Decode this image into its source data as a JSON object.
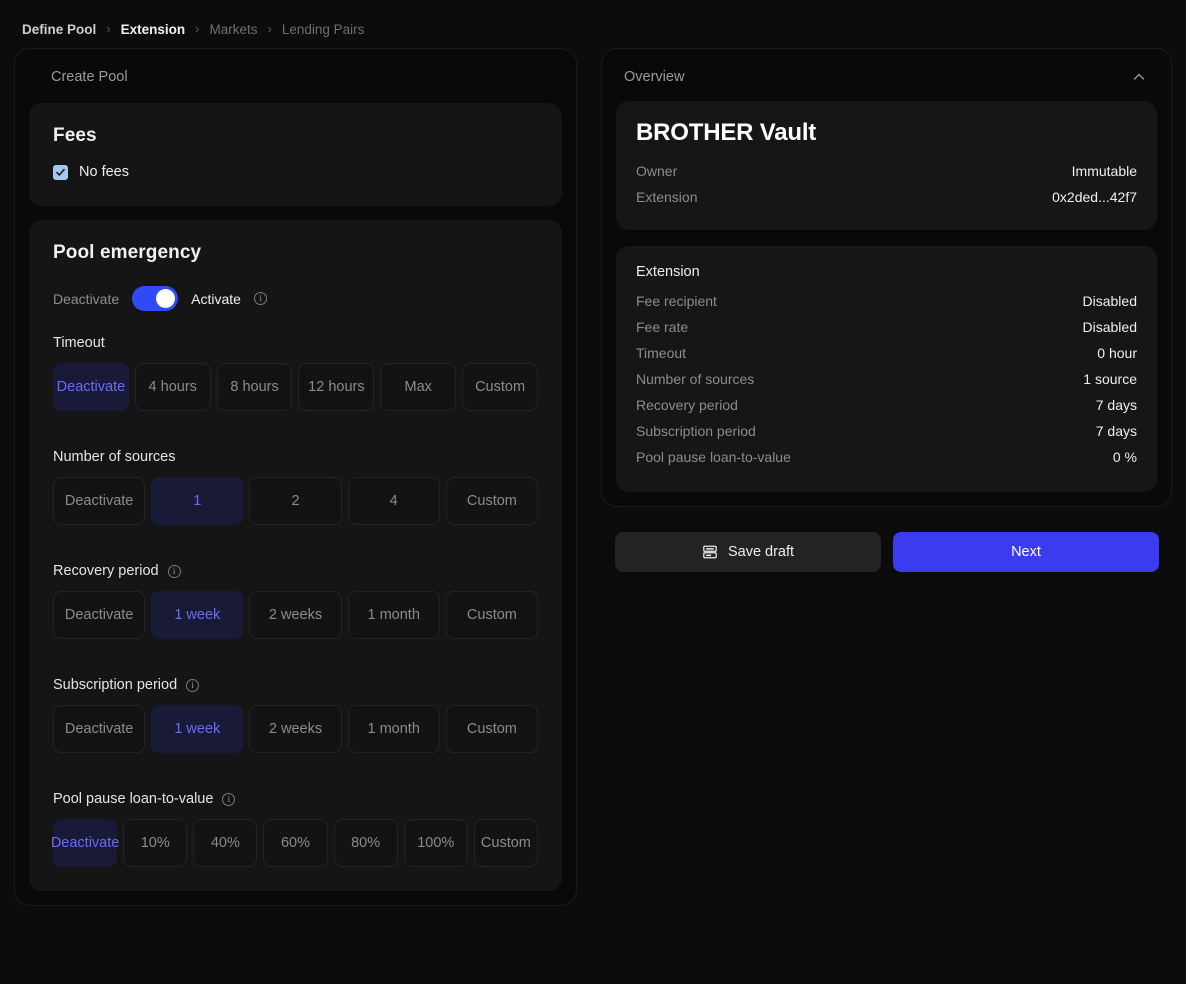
{
  "breadcrumb": [
    {
      "label": "Define Pool",
      "state": "done"
    },
    {
      "label": "Extension",
      "state": "active"
    },
    {
      "label": "Markets",
      "state": "todo"
    },
    {
      "label": "Lending Pairs",
      "state": "todo"
    }
  ],
  "breadcrumb_separator": "›",
  "left": {
    "card_title": "Create Pool",
    "fees": {
      "heading": "Fees",
      "checkbox_label": "No fees",
      "checked": true
    },
    "emergency": {
      "heading": "Pool emergency",
      "toggle_off_label": "Deactivate",
      "toggle_on_label": "Activate",
      "toggle_state": "on",
      "info_glyph": "i",
      "fields": [
        {
          "label": "Timeout",
          "has_info": false,
          "options": [
            "Deactivate",
            "4 hours",
            "8 hours",
            "12 hours",
            "Max",
            "Custom"
          ],
          "selected": "Deactivate"
        },
        {
          "label": "Number of sources",
          "has_info": false,
          "options": [
            "Deactivate",
            "1",
            "2",
            "4",
            "Custom"
          ],
          "selected": "1"
        },
        {
          "label": "Recovery period",
          "has_info": true,
          "options": [
            "Deactivate",
            "1 week",
            "2 weeks",
            "1 month",
            "Custom"
          ],
          "selected": "1 week"
        },
        {
          "label": "Subscription period",
          "has_info": true,
          "options": [
            "Deactivate",
            "1 week",
            "2 weeks",
            "1 month",
            "Custom"
          ],
          "selected": "1 week"
        },
        {
          "label": "Pool pause loan-to-value",
          "has_info": true,
          "options": [
            "Deactivate",
            "10%",
            "40%",
            "60%",
            "80%",
            "100%",
            "Custom"
          ],
          "selected": "Deactivate"
        }
      ]
    }
  },
  "right": {
    "overview_title": "Overview",
    "collapse_icon": "chevron-up-icon",
    "vault": {
      "name": "BROTHER Vault",
      "rows": [
        {
          "key": "Owner",
          "value": "Immutable"
        },
        {
          "key": "Extension",
          "value": "0x2ded...42f7"
        }
      ]
    },
    "extension": {
      "heading": "Extension",
      "rows": [
        {
          "key": "Fee recipient",
          "value": "Disabled"
        },
        {
          "key": "Fee rate",
          "value": "Disabled"
        },
        {
          "key": "Timeout",
          "value": "0 hour"
        },
        {
          "key": "Number of sources",
          "value": "1 source"
        },
        {
          "key": "Recovery period",
          "value": "7 days"
        },
        {
          "key": "Subscription period",
          "value": "7 days"
        },
        {
          "key": "Pool pause loan-to-value",
          "value": "0 %"
        }
      ]
    },
    "actions": {
      "save_draft_label": "Save draft",
      "save_draft_icon": "server-save-icon",
      "next_label": "Next"
    }
  },
  "colors": {
    "accent_blue": "#3b3bf0",
    "chip_selected_bg": "#191a38",
    "chip_selected_text": "#6b6bf5",
    "checkbox": "#a7c7f2"
  }
}
